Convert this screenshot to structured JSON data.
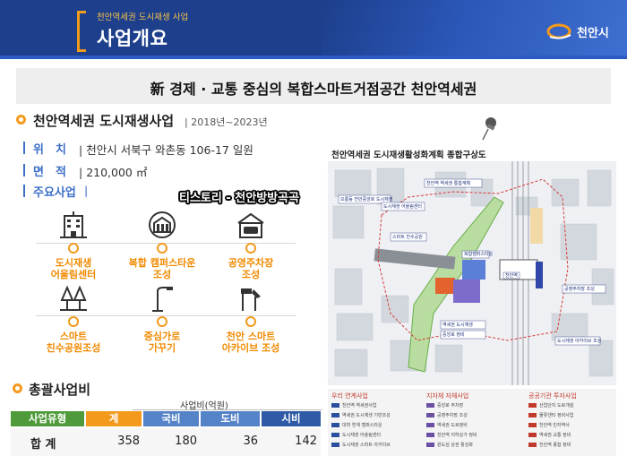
{
  "header": {
    "breadcrumb": "천안역세권 도시재생 사업",
    "title": "사업개요",
    "logo_text": "천안시",
    "colors": {
      "bar": "#1d3f8c",
      "accent": "#f29a1a"
    }
  },
  "headline": "新 경제 · 교통 중심의 복합스마트거점공간 천안역세권",
  "section1": {
    "title": "천안역세권 도시재생사업",
    "period": "2018년~2023년",
    "fields": [
      {
        "label": "위치",
        "value": "천안시 서북구 와촌동 106-17 일원"
      },
      {
        "label": "면적",
        "value": "210,000 ㎡"
      },
      {
        "label": "주요사업",
        "value": ""
      }
    ]
  },
  "watermark": "티스토리 - 천안방방곡곡",
  "projects": [
    {
      "icon": "building-icon",
      "label_lines": [
        "도시재생",
        "어울림센터"
      ]
    },
    {
      "icon": "campus-icon",
      "label_lines": [
        "복합 캠퍼스타운",
        "조성"
      ]
    },
    {
      "icon": "parking-icon",
      "label_lines": [
        "공영주차장",
        "조성"
      ]
    },
    {
      "icon": "park-trees-icon",
      "label_lines": [
        "스마트",
        "친수공원조성"
      ]
    },
    {
      "icon": "streetlight-icon",
      "label_lines": [
        "중심가로",
        "가꾸기"
      ]
    },
    {
      "icon": "archive-tools-icon",
      "label_lines": [
        "천안 스마트",
        "아카이브 조성"
      ]
    }
  ],
  "section2": {
    "title": "총괄사업비",
    "unit_label": "사업비(억원)",
    "table": {
      "headers": [
        "사업유형",
        "계",
        "국비",
        "도비",
        "시비"
      ],
      "header_colors": [
        "#4f9b3b",
        "#f39a1d",
        "#5583c8",
        "#5583c8",
        "#2f5aa6"
      ],
      "rows": [
        {
          "type": "합 계",
          "total": "358",
          "national": "180",
          "province": "36",
          "city": "142"
        }
      ]
    }
  },
  "map": {
    "title": "천안역세권 도시재생활성화계획 종합구상도",
    "legend_heads": [
      "우리 연계사업",
      "지자체 자체사업",
      "공공기관 투자사업"
    ],
    "legend_rows": [
      [
        "천안역 역세권사업",
        "중앙로 주차장",
        "산업단지 도로개설"
      ],
      [
        "역세권 도시재생 기반조성",
        "공영주차장 조성",
        "물류센터 정비사업"
      ],
      [
        "대학 연계 캠퍼스타운",
        "역세권 도로정비",
        "천안역 민자역사"
      ],
      [
        "도시재생 어울림센터",
        "천안역 지하상가 정비",
        "역세권 교통 정비"
      ],
      [
        "도시재생 스마트 아카이브",
        "원도심 상권 활성화",
        "천안역 종합 정비"
      ]
    ],
    "map_labels": [
      "오룡동 천안중앙로 도시재생",
      "천안역 역세권 통합계획",
      "도시재생 어울림센터",
      "스마트 친수공원",
      "천안역",
      "공영주차장 조성",
      "복합캠퍼스타운",
      "역세권 도시재생",
      "중앙로 정비",
      "도시재생 아카이브 조성"
    ]
  }
}
